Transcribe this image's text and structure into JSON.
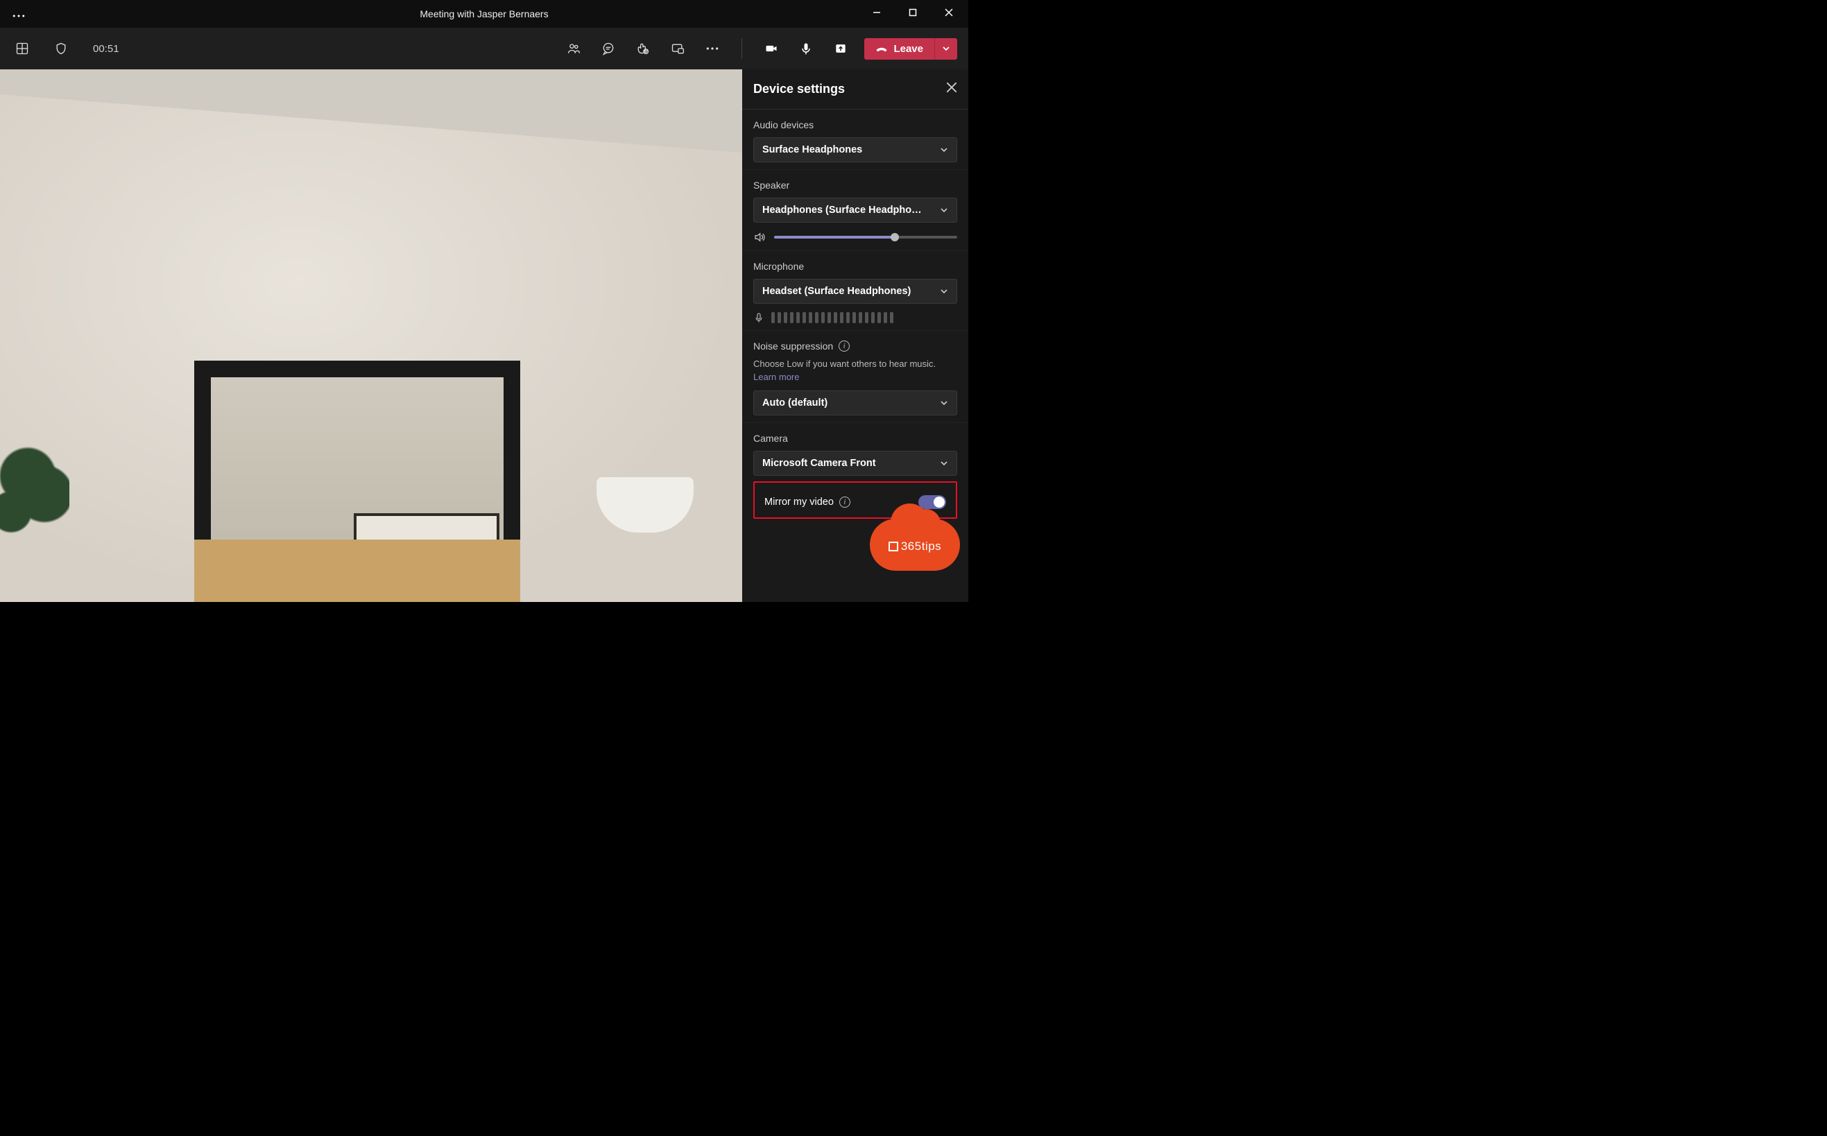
{
  "titlebar": {
    "title": "Meeting with Jasper Bernaers"
  },
  "toolbar": {
    "timer": "00:51",
    "leave_label": "Leave"
  },
  "panel": {
    "title": "Device settings",
    "audio_devices_label": "Audio devices",
    "audio_device_value": "Surface Headphones",
    "speaker_label": "Speaker",
    "speaker_value": "Headphones (Surface Headphon...",
    "speaker_volume_percent": 66,
    "microphone_label": "Microphone",
    "microphone_value": "Headset (Surface Headphones)",
    "noise_suppression_label": "Noise suppression",
    "noise_suppression_hint": "Choose Low if you want others to hear music.",
    "learn_more": "Learn more",
    "noise_suppression_value": "Auto (default)",
    "camera_label": "Camera",
    "camera_value": "Microsoft Camera Front",
    "mirror_label": "Mirror my video",
    "mirror_on": true
  },
  "badge": {
    "text": "365tips"
  },
  "colors": {
    "leave_red": "#c4314b",
    "accent_purple": "#6264a7",
    "highlight_red": "#e81123",
    "badge_orange": "#e8491f"
  }
}
